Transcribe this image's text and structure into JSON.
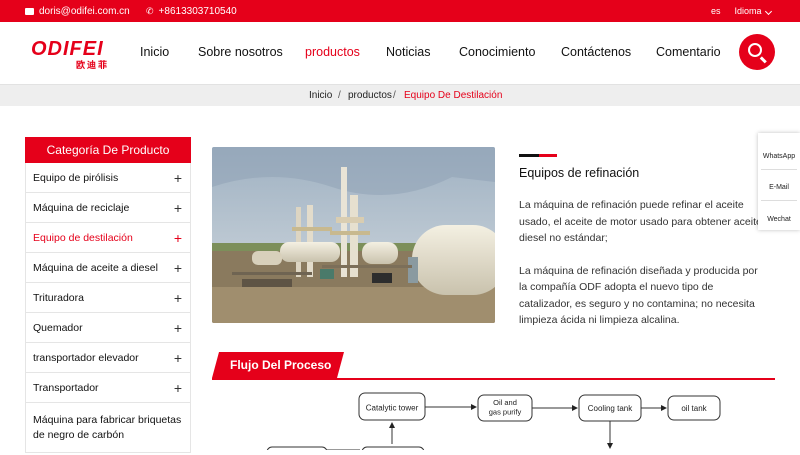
{
  "topbar": {
    "email": "doris@odifei.com.cn",
    "phone": "+8613303710540",
    "lang_code": "es",
    "lang_label": "Idioma"
  },
  "logo": {
    "brand": "ODIFEI",
    "cn": "欧迪菲"
  },
  "nav": [
    {
      "label": "Inicio",
      "active": false
    },
    {
      "label": "Sobre nosotros",
      "active": false
    },
    {
      "label": "productos",
      "active": true
    },
    {
      "label": "Noticias",
      "active": false
    },
    {
      "label": "Conocimiento",
      "active": false
    },
    {
      "label": "Contáctenos",
      "active": false
    },
    {
      "label": "Comentario",
      "active": false
    }
  ],
  "breadcrumb": {
    "home": "Inicio",
    "sep": "/",
    "section": "productos",
    "current": "Equipo De Destilación"
  },
  "sidebar": {
    "title": "Categoría De Producto",
    "items": [
      {
        "label": "Equipo de pirólisis",
        "active": false
      },
      {
        "label": "Máquina de reciclaje",
        "active": false
      },
      {
        "label": "Equipo de destilación",
        "active": true
      },
      {
        "label": "Máquina de aceite a diesel",
        "active": false
      },
      {
        "label": "Trituradora",
        "active": false
      },
      {
        "label": "Quemador",
        "active": false
      },
      {
        "label": "transportador elevador",
        "active": false
      },
      {
        "label": "Transportador",
        "active": false
      },
      {
        "label": "Máquina para fabricar briquetas de negro de carbón",
        "active": false
      }
    ],
    "plus": "+"
  },
  "product": {
    "title": "Equipos de refinación",
    "paragraphs": [
      "La máquina de refinación puede refinar el aceite usado, el aceite de motor usado para obtener aceite diesel no estándar;",
      "La máquina de refinación diseñada y producida por la compañía ODF adopta el nuevo tipo de catalizador, es seguro y no contamina; no necesita limpieza ácida ni limpieza alcalina."
    ]
  },
  "contact_float": {
    "whatsapp": "WhatsApp",
    "email": "E-Mail",
    "wechat": "Wechat"
  },
  "process": {
    "title": "Flujo Del Proceso",
    "nodes": [
      "Catalytic tower",
      "Oil and gas purify",
      "Cooling tank",
      "oil tank"
    ]
  },
  "colors": {
    "accent": "#e5001a",
    "breadcrumb_bg": "#eeeeee"
  }
}
